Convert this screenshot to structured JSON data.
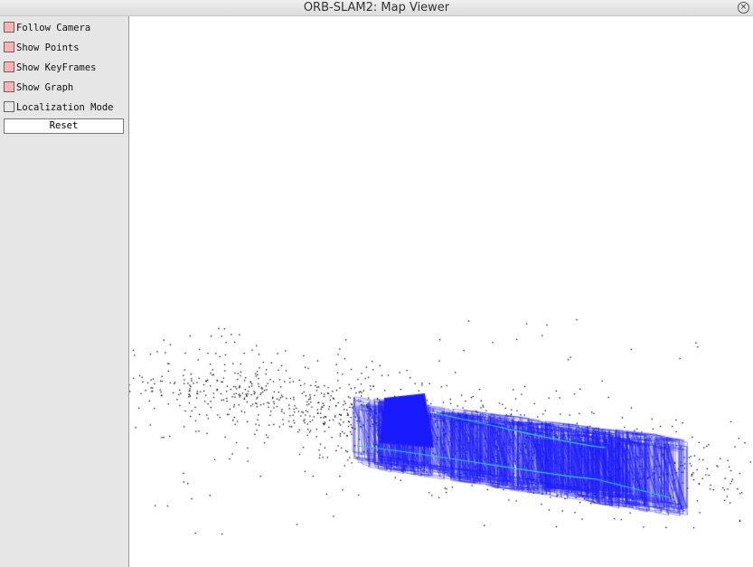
{
  "window": {
    "title": "ORB-SLAM2: Map Viewer",
    "close_icon": "close-icon"
  },
  "panel": {
    "items": [
      {
        "label": "Follow Camera",
        "checked": true
      },
      {
        "label": "Show Points",
        "checked": true
      },
      {
        "label": "Show KeyFrames",
        "checked": true
      },
      {
        "label": "Show Graph",
        "checked": true
      },
      {
        "label": "Localization Mode",
        "checked": false
      }
    ],
    "reset_label": "Reset"
  },
  "colors": {
    "keyframes": "#1a1aff",
    "graph": "#33cc99",
    "points": "#000000",
    "checkbox_on": "#ffb0b0"
  }
}
